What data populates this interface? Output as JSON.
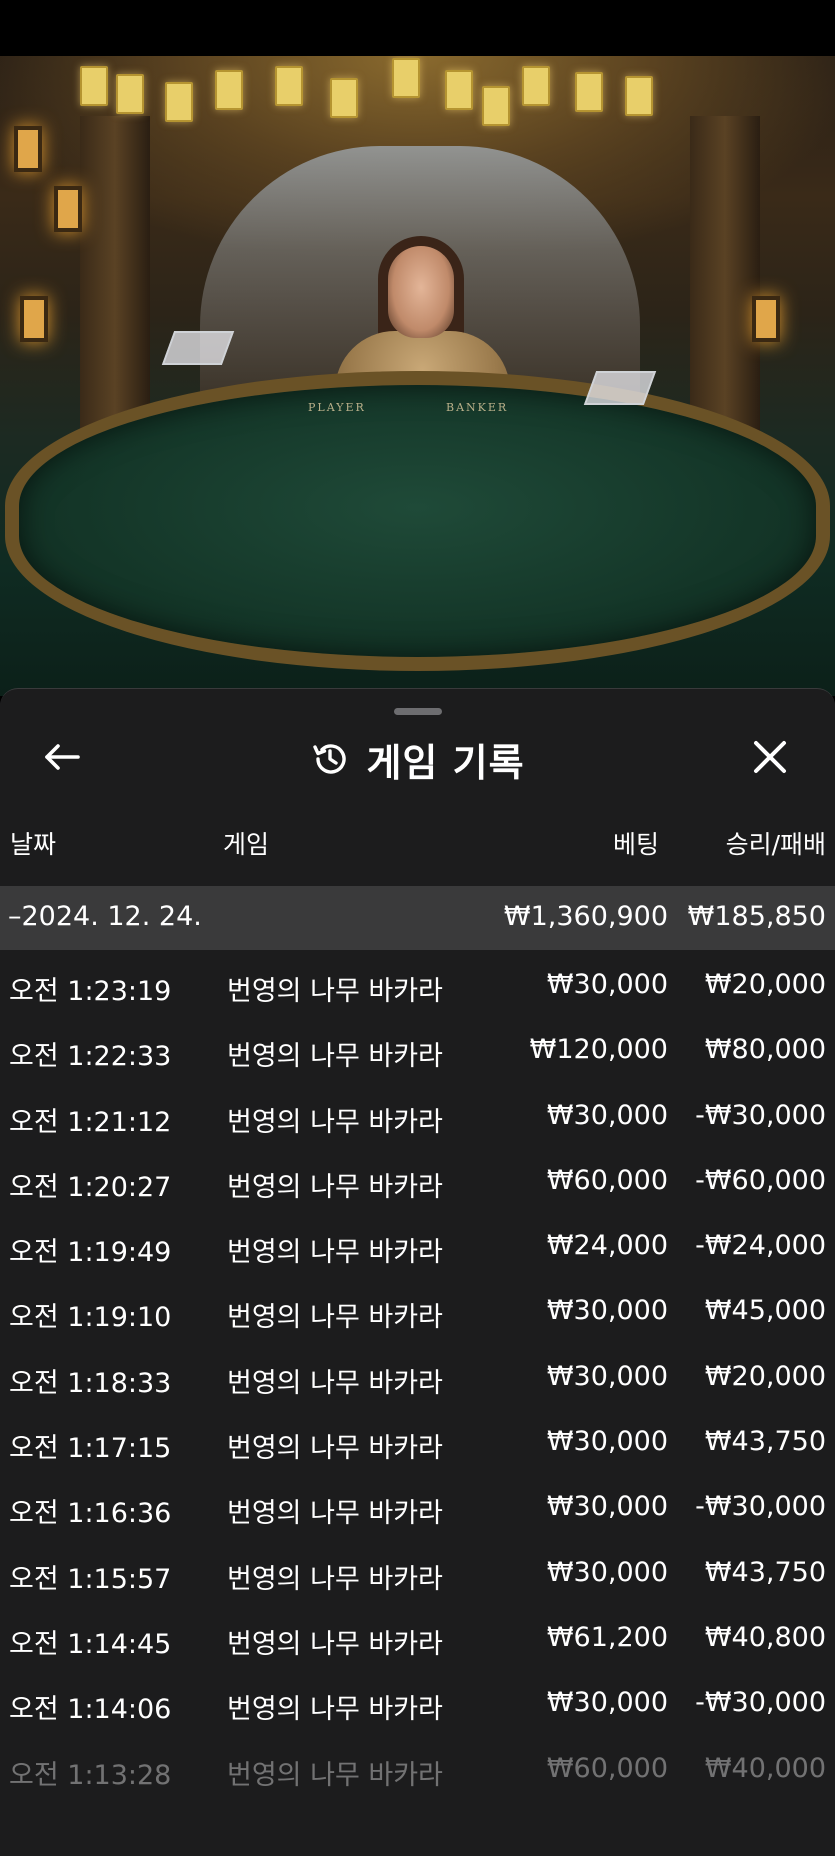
{
  "history": {
    "title": "게임 기록",
    "columns": {
      "date": "날짜",
      "game": "게임",
      "bet": "베팅",
      "result": "승리/패배"
    },
    "summary": {
      "date": "–2024. 12. 24.",
      "bet": "₩1,360,900",
      "result": "₩185,850"
    },
    "rows": [
      {
        "time": "오전 1:23:19",
        "game": "번영의 나무 바카라",
        "bet": "₩30,000",
        "result": "₩20,000"
      },
      {
        "time": "오전 1:22:33",
        "game": "번영의 나무 바카라",
        "bet": "₩120,000",
        "result": "₩80,000"
      },
      {
        "time": "오전 1:21:12",
        "game": "번영의 나무 바카라",
        "bet": "₩30,000",
        "result": "-₩30,000"
      },
      {
        "time": "오전 1:20:27",
        "game": "번영의 나무 바카라",
        "bet": "₩60,000",
        "result": "-₩60,000"
      },
      {
        "time": "오전 1:19:49",
        "game": "번영의 나무 바카라",
        "bet": "₩24,000",
        "result": "-₩24,000"
      },
      {
        "time": "오전 1:19:10",
        "game": "번영의 나무 바카라",
        "bet": "₩30,000",
        "result": "₩45,000"
      },
      {
        "time": "오전 1:18:33",
        "game": "번영의 나무 바카라",
        "bet": "₩30,000",
        "result": "₩20,000"
      },
      {
        "time": "오전 1:17:15",
        "game": "번영의 나무 바카라",
        "bet": "₩30,000",
        "result": "₩43,750"
      },
      {
        "time": "오전 1:16:36",
        "game": "번영의 나무 바카라",
        "bet": "₩30,000",
        "result": "-₩30,000"
      },
      {
        "time": "오전 1:15:57",
        "game": "번영의 나무 바카라",
        "bet": "₩30,000",
        "result": "₩43,750"
      },
      {
        "time": "오전 1:14:45",
        "game": "번영의 나무 바카라",
        "bet": "₩61,200",
        "result": "₩40,800"
      },
      {
        "time": "오전 1:14:06",
        "game": "번영의 나무 바카라",
        "bet": "₩30,000",
        "result": "-₩30,000"
      },
      {
        "time": "오전 1:13:28",
        "game": "번영의 나무 바카라",
        "bet": "₩60,000",
        "result": "₩40,000"
      }
    ]
  },
  "video": {
    "table_labels": {
      "player": "PLAYER",
      "banker": "BANKER"
    }
  },
  "icons": {
    "back": "arrow-left-icon",
    "history": "history-clock-icon",
    "close": "close-icon"
  },
  "colors": {
    "panel_bg": "#1c1c1d",
    "summary_bg": "#3a3a3b",
    "text": "#ffffff"
  }
}
